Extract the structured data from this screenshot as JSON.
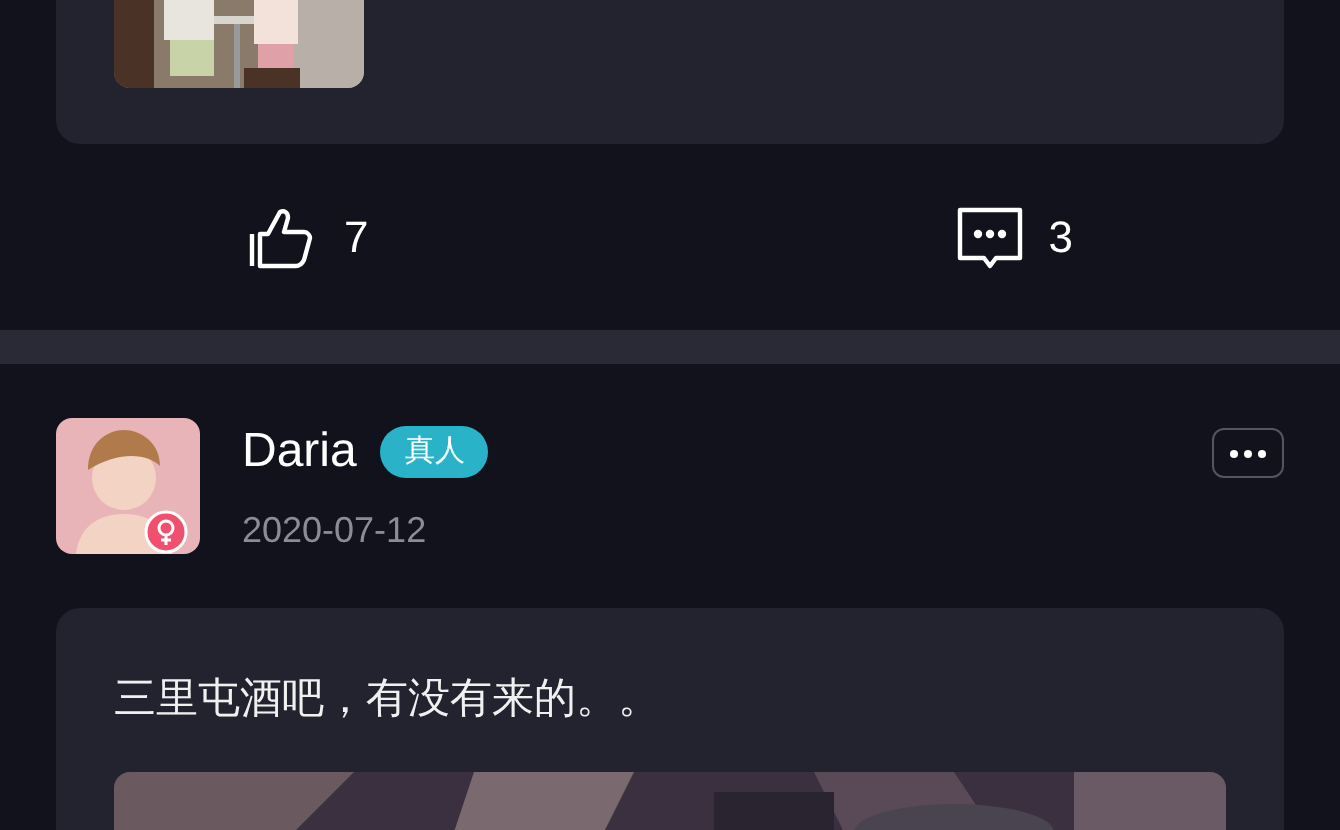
{
  "posts": [
    {
      "kind": "partial",
      "likes": "7",
      "comments": "3"
    },
    {
      "kind": "full",
      "author": "Daria",
      "badge": "真人",
      "gender_mark": {
        "kind": "female"
      },
      "date": "2020-07-12",
      "text": "三里屯酒吧，有没有来的。。"
    }
  ]
}
